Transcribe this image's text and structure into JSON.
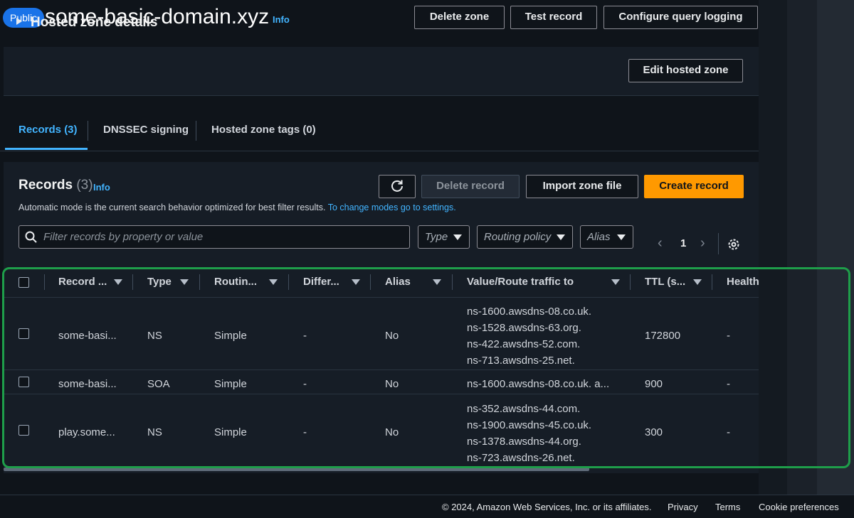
{
  "header": {
    "badge": "Public",
    "title": "some-basic-domain.xyz",
    "info": "Info",
    "buttons": {
      "delete_zone": "Delete zone",
      "test_record": "Test record",
      "configure_logging": "Configure query logging"
    }
  },
  "details": {
    "title": "Hosted zone details",
    "edit_button": "Edit hosted zone"
  },
  "tabs": [
    {
      "label": "Records (3)",
      "active": true
    },
    {
      "label": "DNSSEC signing",
      "active": false
    },
    {
      "label": "Hosted zone tags (0)",
      "active": false
    }
  ],
  "records": {
    "title": "Records",
    "count": "(3)",
    "info": "Info",
    "refresh_icon": "refresh-icon",
    "delete_button": "Delete record",
    "import_button": "Import zone file",
    "create_button": "Create record",
    "mode_text": "Automatic mode is the current search behavior optimized for best filter results.",
    "mode_link": "To change modes go to settings.",
    "search_placeholder": "Filter records by property or value",
    "filters": {
      "type": "Type",
      "routing": "Routing policy",
      "alias": "Alias"
    },
    "page": "1",
    "columns": [
      "Record ...",
      "Type",
      "Routin...",
      "Differ...",
      "Alias",
      "Value/Route traffic to",
      "TTL (s...",
      "Health"
    ],
    "rows": [
      {
        "name": "some-basi...",
        "type": "NS",
        "routing": "Simple",
        "differ": "-",
        "alias": "No",
        "values": [
          "ns-1600.awsdns-08.co.uk.",
          "ns-1528.awsdns-63.org.",
          "ns-422.awsdns-52.com.",
          "ns-713.awsdns-25.net."
        ],
        "ttl": "172800",
        "health": "-"
      },
      {
        "name": "some-basi...",
        "type": "SOA",
        "routing": "Simple",
        "differ": "-",
        "alias": "No",
        "values": [
          "ns-1600.awsdns-08.co.uk. a..."
        ],
        "ttl": "900",
        "health": "-"
      },
      {
        "name": "play.some...",
        "type": "NS",
        "routing": "Simple",
        "differ": "-",
        "alias": "No",
        "values": [
          "ns-352.awsdns-44.com.",
          "ns-1900.awsdns-45.co.uk.",
          "ns-1378.awsdns-44.org.",
          "ns-723.awsdns-26.net."
        ],
        "ttl": "300",
        "health": "-"
      }
    ]
  },
  "footer": {
    "copyright": "© 2024, Amazon Web Services, Inc. or its affiliates.",
    "privacy": "Privacy",
    "terms": "Terms",
    "cookies": "Cookie preferences"
  },
  "colors": {
    "accent": "#42b4ff",
    "primary": "#ff9900",
    "highlight": "#1e9e4a"
  }
}
